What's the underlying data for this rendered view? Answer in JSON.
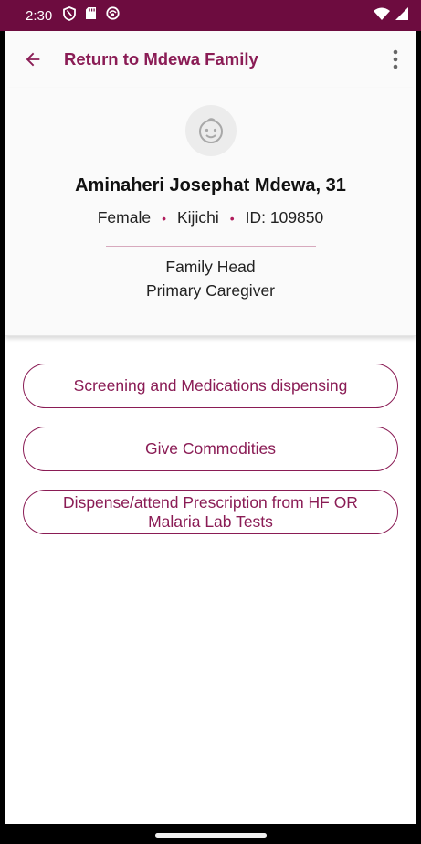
{
  "status_bar": {
    "time": "2:30",
    "left_icons": [
      "shield-icon",
      "sd-card-icon",
      "app-notification-icon"
    ],
    "right_icons": [
      "wifi-icon",
      "signal-icon"
    ]
  },
  "toolbar": {
    "back_icon": "arrow-back-icon",
    "title": "Return to Mdewa Family",
    "menu_icon": "more-vert-icon"
  },
  "profile": {
    "avatar_icon": "baby-face-icon",
    "name": "Aminaheri Josephat Mdewa, 31",
    "gender": "Female",
    "village": "Kijichi",
    "id_text": "ID: 109850",
    "role_1": "Family Head",
    "role_2": "Primary Caregiver"
  },
  "actions": {
    "screening": "Screening and Medications dispensing",
    "commodities": "Give Commodities",
    "prescription": "Dispense/attend Prescription from HF OR Malaria Lab Tests"
  },
  "colors": {
    "primary": "#8a1c55",
    "status_bar": "#6d0c3f"
  }
}
